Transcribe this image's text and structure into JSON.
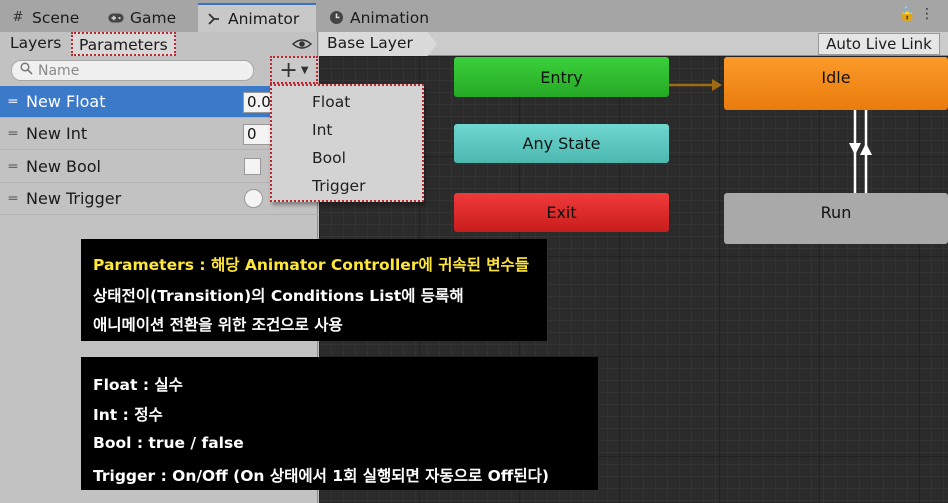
{
  "tabs": [
    {
      "label": "Scene",
      "icon": "grid-icon"
    },
    {
      "label": "Game",
      "icon": "gamepad-icon"
    },
    {
      "label": "Animator",
      "icon": "animator-icon"
    },
    {
      "label": "Animation",
      "icon": "clock-icon"
    }
  ],
  "left_panel": {
    "subtabs": {
      "layers": "Layers",
      "parameters": "Parameters"
    },
    "search_placeholder": "Name",
    "add_button": "+",
    "parameters": [
      {
        "name": "New Float",
        "type": "float",
        "value": "0.0"
      },
      {
        "name": "New Int",
        "type": "int",
        "value": "0"
      },
      {
        "name": "New Bool",
        "type": "bool",
        "value": false
      },
      {
        "name": "New Trigger",
        "type": "trigger",
        "value": false
      }
    ],
    "add_menu": [
      "Float",
      "Int",
      "Bool",
      "Trigger"
    ]
  },
  "graph": {
    "breadcrumb": "Base Layer",
    "auto_live_link": "Auto Live Link",
    "states": {
      "entry": "Entry",
      "any_state": "Any State",
      "exit": "Exit",
      "idle": "Idle",
      "run": "Run"
    },
    "colors": {
      "entry": "#2fc02f",
      "any_state": "#5cc8c0",
      "exit": "#dd2a2a",
      "idle": "#f28a16",
      "run": "#a9a9a9",
      "transition": "#a06a10"
    }
  },
  "annotations": {
    "box1": {
      "line1_highlight": "Parameters : ",
      "line1_rest_yellow": "해당 Animator Controller에 귀속된 변수들",
      "line2": "상태전이(Transition)의 Conditions List에 등록해",
      "line3": "애니메이션 전환을 위한 조건으로 사용"
    },
    "box2": {
      "line1": "Float : 실수",
      "line2": "Int : 정수",
      "line3": "Bool : true / false",
      "line4": "Trigger : On/Off (On 상태에서 1회 실행되면 자동으로 Off된다)"
    }
  }
}
